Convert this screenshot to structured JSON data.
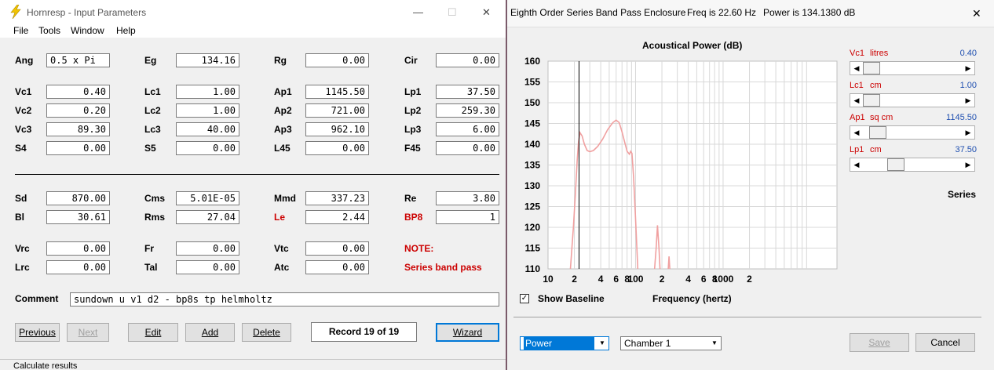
{
  "input_window": {
    "title": "Hornresp - Input Parameters",
    "menu": [
      "File",
      "Tools",
      "Window",
      "Help"
    ],
    "rows_top": [
      [
        {
          "label": "Ang",
          "value": "0.5 x Pi",
          "align": "left"
        },
        {
          "label": "Eg",
          "value": "134.16"
        },
        {
          "label": "Rg",
          "value": "0.00"
        },
        {
          "label": "Cir",
          "value": "0.00"
        }
      ],
      [
        {
          "label": "Vc1",
          "value": "0.40"
        },
        {
          "label": "Lc1",
          "value": "1.00"
        },
        {
          "label": "Ap1",
          "value": "1145.50"
        },
        {
          "label": "Lp1",
          "value": "37.50"
        }
      ],
      [
        {
          "label": "Vc2",
          "value": "0.20"
        },
        {
          "label": "Lc2",
          "value": "1.00"
        },
        {
          "label": "Ap2",
          "value": "721.00"
        },
        {
          "label": "Lp2",
          "value": "259.30"
        }
      ],
      [
        {
          "label": "Vc3",
          "value": "89.30"
        },
        {
          "label": "Lc3",
          "value": "40.00"
        },
        {
          "label": "Ap3",
          "value": "962.10"
        },
        {
          "label": "Lp3",
          "value": "6.00"
        }
      ],
      [
        {
          "label": "S4",
          "value": "0.00"
        },
        {
          "label": "S5",
          "value": "0.00"
        },
        {
          "label": "L45",
          "value": "0.00"
        },
        {
          "label": "F45",
          "value": "0.00"
        }
      ]
    ],
    "rows_mid": [
      [
        {
          "label": "Sd",
          "value": "870.00"
        },
        {
          "label": "Cms",
          "value": "5.01E-05"
        },
        {
          "label": "Mmd",
          "value": "337.23"
        },
        {
          "label": "Re",
          "value": "3.80"
        }
      ],
      [
        {
          "label": "Bl",
          "value": "30.61"
        },
        {
          "label": "Rms",
          "value": "27.04"
        },
        {
          "label": "Le",
          "value": "2.44",
          "red": true
        },
        {
          "label": "BP8",
          "value": "1",
          "red": true
        }
      ]
    ],
    "rows_bottom": [
      [
        {
          "label": "Vrc",
          "value": "0.00"
        },
        {
          "label": "Fr",
          "value": "0.00"
        },
        {
          "label": "Vtc",
          "value": "0.00"
        }
      ],
      [
        {
          "label": "Lrc",
          "value": "0.00"
        },
        {
          "label": "Tal",
          "value": "0.00"
        },
        {
          "label": "Atc",
          "value": "0.00"
        }
      ]
    ],
    "note_label": "NOTE:",
    "note_text": "Series band pass",
    "comment_label": "Comment",
    "comment_value": "sundown u v1 d2 - bp8s tp helmholtz",
    "buttons": {
      "previous": "Previous",
      "next": "Next",
      "edit": "Edit",
      "add": "Add",
      "delete": "Delete",
      "wizard": "Wizard"
    },
    "record": "Record 19 of 19",
    "status": "Calculate results"
  },
  "chart_window": {
    "title": "Eighth Order Series Band Pass Enclosure",
    "freq": "Freq is 22.60 Hz",
    "power": "Power is 134.1380 dB",
    "show_baseline": "Show Baseline",
    "plot_select": "Power",
    "chamber_select": "Chamber 1",
    "save_label": "Save",
    "cancel_label": "Cancel",
    "series_label": "Series",
    "sliders": [
      {
        "name": "Vc1",
        "unit": "litres",
        "value": "0.40",
        "position": 0.0
      },
      {
        "name": "Lc1",
        "unit": "cm",
        "value": "1.00",
        "position": 0.0
      },
      {
        "name": "Ap1",
        "unit": "sq cm",
        "value": "1145.50",
        "position": 0.08
      },
      {
        "name": "Lp1",
        "unit": "cm",
        "value": "37.50",
        "position": 0.3
      }
    ],
    "colors": {
      "curve": "#f0a0a0",
      "cursor": "#000000",
      "grid": "#d8d8d8"
    }
  },
  "chart_data": {
    "type": "line",
    "title": "Acoustical Power (dB)",
    "xlabel": "Frequency (hertz)",
    "ylabel": "",
    "x_scale": "log",
    "xlim": [
      10,
      20000
    ],
    "ylim": [
      110,
      160
    ],
    "x_ticks": [
      {
        "v": 10,
        "t": "10"
      },
      {
        "v": 20,
        "t": "2"
      },
      {
        "v": 40,
        "t": "4"
      },
      {
        "v": 60,
        "t": "6"
      },
      {
        "v": 80,
        "t": "8"
      },
      {
        "v": 100,
        "t": "100"
      },
      {
        "v": 200,
        "t": "2"
      },
      {
        "v": 400,
        "t": "4"
      },
      {
        "v": 600,
        "t": "6"
      },
      {
        "v": 800,
        "t": "8"
      },
      {
        "v": 1000,
        "t": "1000"
      },
      {
        "v": 2000,
        "t": "2"
      }
    ],
    "y_ticks": [
      110,
      115,
      120,
      125,
      130,
      135,
      140,
      145,
      150,
      155,
      160
    ],
    "cursor_x": 22.6,
    "grid": true,
    "series": [
      {
        "points": [
          [
            18,
            110
          ],
          [
            19.5,
            120
          ],
          [
            20.5,
            128
          ],
          [
            21.5,
            136
          ],
          [
            22.3,
            140.5
          ],
          [
            23.2,
            142.8
          ],
          [
            24.5,
            142
          ],
          [
            26,
            140
          ],
          [
            28,
            138.5
          ],
          [
            30,
            138.2
          ],
          [
            33,
            138.5
          ],
          [
            37,
            139.5
          ],
          [
            42,
            141.2
          ],
          [
            48,
            143.5
          ],
          [
            55,
            145.2
          ],
          [
            60,
            145.8
          ],
          [
            65,
            145.2
          ],
          [
            70,
            143
          ],
          [
            75,
            140.5
          ],
          [
            80,
            138.3
          ],
          [
            85,
            137.6
          ],
          [
            88,
            138.3
          ],
          [
            91,
            137.8
          ],
          [
            95,
            132
          ],
          [
            100,
            122
          ],
          [
            106,
            110
          ]
        ]
      },
      {
        "points": [
          [
            165,
            110
          ],
          [
            172,
            115
          ],
          [
            178,
            120.5
          ],
          [
            185,
            115
          ],
          [
            190,
            110
          ]
        ]
      },
      {
        "points": [
          [
            236,
            110
          ],
          [
            241,
            113
          ],
          [
            246,
            110
          ]
        ]
      }
    ]
  }
}
